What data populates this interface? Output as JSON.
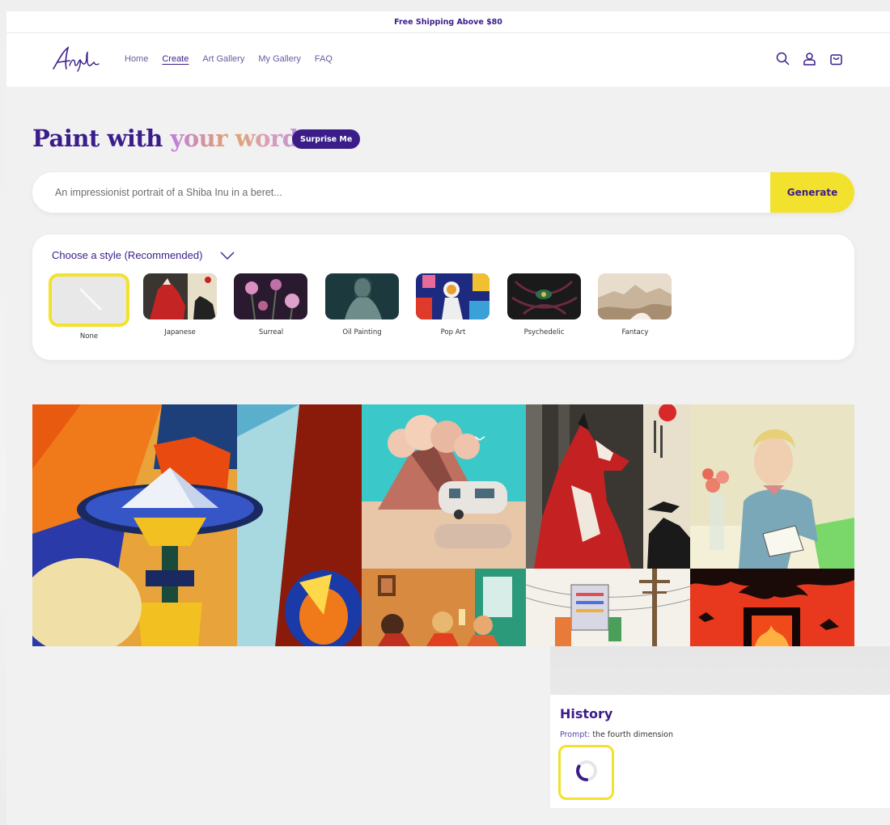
{
  "announcement": "Free Shipping Above $80",
  "nav": {
    "items": [
      {
        "label": "Home",
        "active": false
      },
      {
        "label": "Create",
        "active": true
      },
      {
        "label": "Art Gallery",
        "active": false
      },
      {
        "label": "My Gallery",
        "active": false
      },
      {
        "label": "FAQ",
        "active": false
      }
    ],
    "icons": [
      "search-icon",
      "account-icon",
      "cart-icon"
    ]
  },
  "hero": {
    "title_plain": "Paint with ",
    "title_gradient": "your words",
    "surprise_label": "Surprise Me"
  },
  "prompt": {
    "placeholder": "An impressionist portrait of a Shiba Inu in a beret...",
    "value": "",
    "generate_label": "Generate"
  },
  "styles": {
    "header": "Choose a style (Recommended)",
    "items": [
      {
        "label": "None",
        "selected": true
      },
      {
        "label": "Japanese",
        "selected": false
      },
      {
        "label": "Surreal",
        "selected": false
      },
      {
        "label": "Oil Painting",
        "selected": false
      },
      {
        "label": "Pop Art",
        "selected": false
      },
      {
        "label": "Psychedelic",
        "selected": false
      },
      {
        "label": "Fantacy",
        "selected": false
      }
    ]
  },
  "gallery": {
    "tiles": [
      "cubist-still-life",
      "desert-trailer",
      "japanese-fox",
      "portrait-woman",
      "living-room-women",
      "robot-power-lines",
      "red-tree-fire"
    ]
  },
  "history": {
    "title": "History",
    "prompt_key": "Prompt:",
    "prompt_value": "the fourth dimension"
  },
  "colors": {
    "brand": "#3b1d8a",
    "accent": "#f2e12d"
  }
}
